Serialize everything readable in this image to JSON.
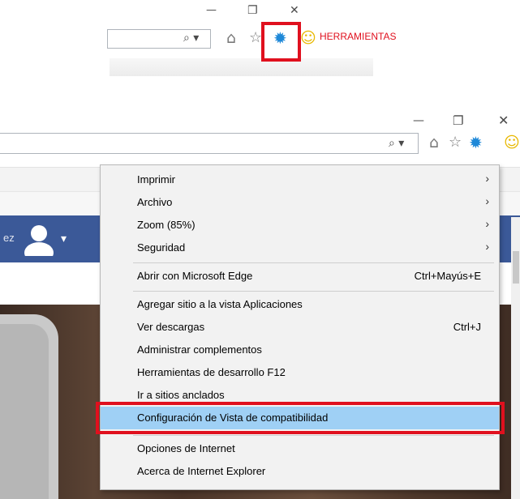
{
  "top_snippet": {
    "minimize_glyph": "—",
    "restore_glyph": "❐",
    "close_glyph": "✕",
    "search_glyph": "⌕ ▾",
    "home_glyph": "⌂",
    "star_glyph": "☆",
    "gear_glyph": "✹",
    "smiley_glyph": "☺",
    "annotation_label": "HERRAMIENTAS"
  },
  "browser": {
    "minimize_glyph": "—",
    "restore_glyph": "❐",
    "close_glyph": "✕",
    "search_glyph": "⌕ ▾",
    "home_glyph": "⌂",
    "star_glyph": "☆",
    "gear_glyph": "✹",
    "smiley_glyph": "☺",
    "profile_prefix": "ez",
    "profile_caret": "▾"
  },
  "menu": {
    "items_group1": [
      {
        "label": "Imprimir",
        "arrow": "›"
      },
      {
        "label": "Archivo",
        "arrow": "›"
      },
      {
        "label": "Zoom (85%)",
        "arrow": "›"
      },
      {
        "label": "Seguridad",
        "arrow": "›"
      }
    ],
    "edge_item": {
      "label": "Abrir con Microsoft Edge",
      "shortcut": "Ctrl+Mayús+E"
    },
    "items_group3": [
      {
        "label": "Agregar sitio a la vista Aplicaciones",
        "shortcut": ""
      },
      {
        "label": "Ver descargas",
        "shortcut": "Ctrl+J"
      },
      {
        "label": "Administrar complementos",
        "shortcut": ""
      },
      {
        "label": "Herramientas de desarrollo F12",
        "shortcut": ""
      },
      {
        "label": "Ir a sitios anclados",
        "shortcut": ""
      }
    ],
    "highlighted_item": {
      "label": "Configuración de Vista de compatibilidad"
    },
    "items_group4": [
      {
        "label": "Opciones de Internet"
      },
      {
        "label": "Acerca de Internet Explorer"
      }
    ]
  },
  "colors": {
    "annotation_red": "#e0101e",
    "highlight_blue": "#9fd0f5",
    "gear_blue": "#1e88d8",
    "facebook_blue": "#3b5998"
  }
}
